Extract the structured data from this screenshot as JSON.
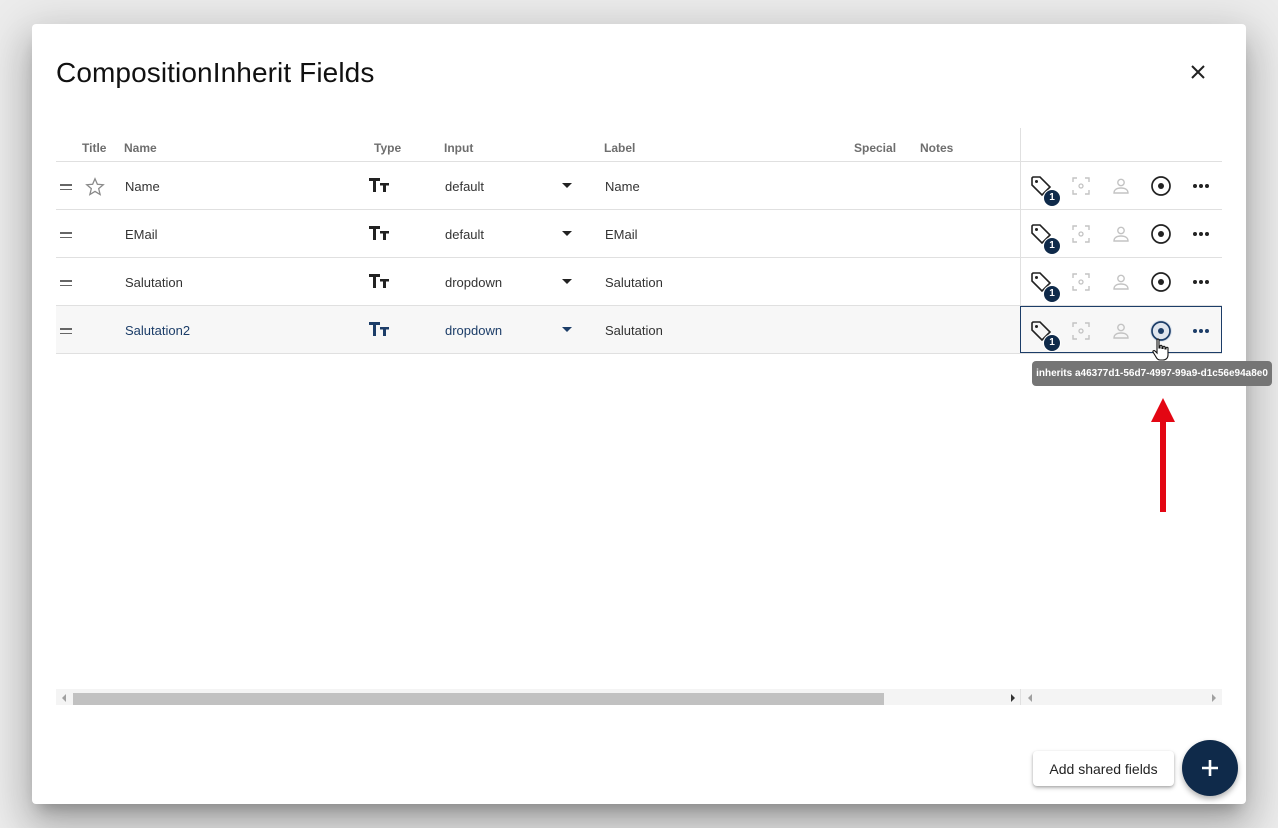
{
  "dialog": {
    "title": "CompositionInherit Fields",
    "close_icon": "close-icon"
  },
  "table": {
    "headers": {
      "title": "Title",
      "name": "Name",
      "type": "Type",
      "input": "Input",
      "label": "Label",
      "special": "Special",
      "notes": "Notes"
    },
    "rows": [
      {
        "name": "Name",
        "type_icon": "text-type-icon",
        "input": "default",
        "label": "Name",
        "is_title": false,
        "tag_count": "1"
      },
      {
        "name": "EMail",
        "type_icon": "text-type-icon",
        "input": "default",
        "label": "EMail",
        "tag_count": "1"
      },
      {
        "name": "Salutation",
        "type_icon": "text-type-icon",
        "input": "dropdown",
        "label": "Salutation",
        "tag_count": "1"
      },
      {
        "name": "Salutation2",
        "type_icon": "text-type-icon",
        "input": "dropdown",
        "label": "Salutation",
        "tag_count": "1",
        "active": true
      }
    ]
  },
  "tooltip": "inherits a46377d1-56d7-4997-99a9-d1c56e94a8e0",
  "footer": {
    "add_shared_label": "Add shared fields",
    "fab_icon": "plus-icon"
  },
  "colors": {
    "primary": "#0f2a4a",
    "annotation_arrow": "#e30613",
    "tooltip_bg": "#757575"
  }
}
